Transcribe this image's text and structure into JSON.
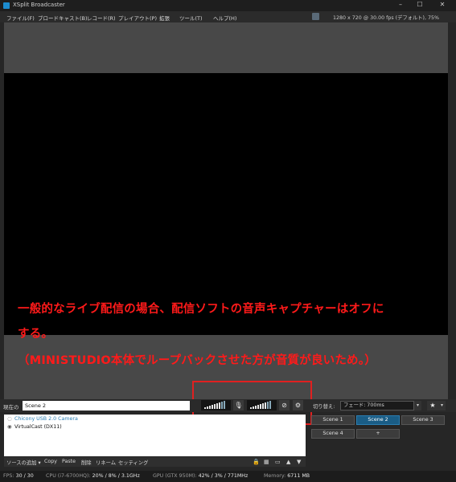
{
  "app": {
    "title": "XSplit Broadcaster"
  },
  "menu": [
    "ファイル(F)",
    "ブロードキャスト(B)",
    "レコード(R)",
    "プレイアウト(P)",
    "拡張",
    "ツール(T)",
    "ヘルプ(H)"
  ],
  "resolution": "1280 x 720 @ 30.00 fps (デフォルト), 75%",
  "annotation": {
    "line1": "一般的なライブ配信の場合、配信ソフトの音声キャプチャーはオフに",
    "line2": "する。",
    "line3": "（MINISTUDIO本体でループバックさせた方が音質が良いため。）",
    "color": "#ff1a1a"
  },
  "scene_bar": {
    "label": "現在の",
    "current_scene": "Scene 2",
    "transition_label": "切り替え:",
    "transition_value": "フェード: 700ms"
  },
  "sources": [
    {
      "name": "Chicony USB 2.0 Camera",
      "icon": "hidden-eye-icon",
      "color": "#2a7fb5"
    },
    {
      "name": "VirtualCast (DX11)",
      "icon": "eye-icon",
      "color": "#111111"
    }
  ],
  "source_toolbar": {
    "add": "ソースの追加 ▾",
    "copy": "Copy",
    "paste": "Paste",
    "delete": "削除",
    "rename": "リネーム",
    "settings": "セッティング"
  },
  "scenes": [
    {
      "label": "Scene 1",
      "active": false
    },
    {
      "label": "Scene 2",
      "active": true
    },
    {
      "label": "Scene 3",
      "active": false
    },
    {
      "label": "Scene 4",
      "active": false
    },
    {
      "label": "+",
      "active": false
    }
  ],
  "status": {
    "fps_label": "FPS:",
    "fps_value": "30 / 30",
    "cpu_label": "CPU (i7-6700HQ):",
    "cpu_value": "20% / 8% / 3.1GHz",
    "gpu_label": "GPU (GTX 950M):",
    "gpu_value": "42% / 3% / 771MHz",
    "mem_label": "Memory:",
    "mem_value": "6711 MB"
  },
  "colors": {
    "accent": "#1a5d86",
    "annotation": "#ff1a1a"
  }
}
